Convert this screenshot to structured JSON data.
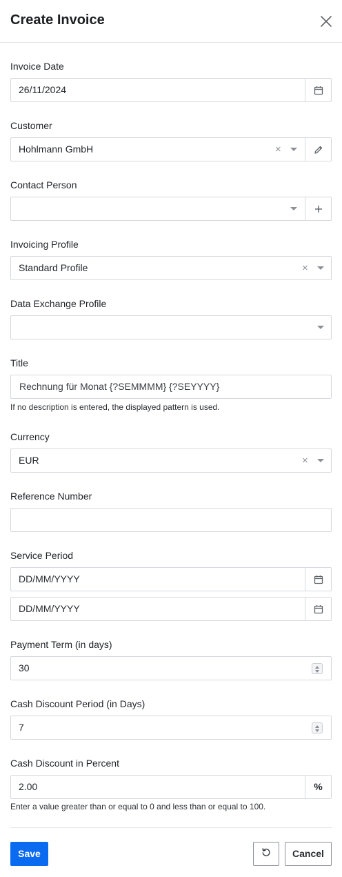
{
  "dialog": {
    "title": "Create Invoice",
    "close_icon": "close-icon"
  },
  "form": {
    "invoice_date": {
      "label": "Invoice Date",
      "value": "26/11/2024",
      "icon": "calendar-icon"
    },
    "customer": {
      "label": "Customer",
      "value": "Hohlmann GmbH",
      "clear_icon": "clear-icon",
      "dropdown_icon": "chevron-down-icon",
      "action_icon": "pencil-icon"
    },
    "contact_person": {
      "label": "Contact Person",
      "value": "",
      "dropdown_icon": "chevron-down-icon",
      "action_icon": "plus-icon"
    },
    "invoicing_profile": {
      "label": "Invoicing Profile",
      "value": "Standard Profile",
      "clear_icon": "clear-icon",
      "dropdown_icon": "chevron-down-icon"
    },
    "data_exchange_profile": {
      "label": "Data Exchange Profile",
      "value": "",
      "dropdown_icon": "chevron-down-icon"
    },
    "title": {
      "label": "Title",
      "placeholder": "Rechnung für Monat {?SEMMMM} {?SEYYYY}",
      "helper": "If no description is entered, the displayed pattern is used."
    },
    "currency": {
      "label": "Currency",
      "value": "EUR",
      "clear_icon": "clear-icon",
      "dropdown_icon": "chevron-down-icon"
    },
    "reference_number": {
      "label": "Reference Number",
      "value": ""
    },
    "service_period": {
      "label": "Service Period",
      "from_placeholder": "DD/MM/YYYY",
      "to_placeholder": "DD/MM/YYYY",
      "icon": "calendar-icon"
    },
    "payment_term": {
      "label": "Payment Term (in days)",
      "value": "30"
    },
    "cash_discount_period": {
      "label": "Cash Discount Period (in Days)",
      "value": "7"
    },
    "cash_discount_percent": {
      "label": "Cash Discount in Percent",
      "value": "2.00",
      "unit": "%",
      "helper": "Enter a value greater than or equal to 0 and less than or equal to 100."
    }
  },
  "footer": {
    "save_label": "Save",
    "reset_icon": "reset-icon",
    "cancel_label": "Cancel"
  },
  "colors": {
    "accent": "#0b6bf0",
    "border": "#d5d8dc",
    "icon": "#8b9096"
  }
}
